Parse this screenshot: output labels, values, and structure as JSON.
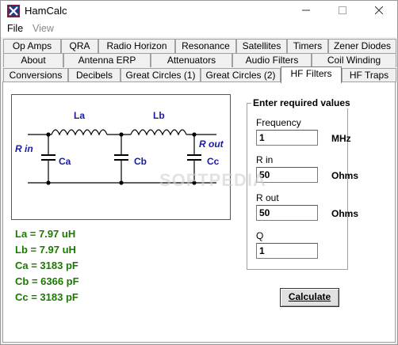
{
  "window": {
    "title": "HamCalc"
  },
  "menu": {
    "file": "File",
    "view": "View"
  },
  "tabs_row1": [
    "Op Amps",
    "QRA",
    "Radio Horizon",
    "Resonance",
    "Satellites",
    "Timers",
    "Zener Diodes"
  ],
  "tabs_row2": [
    "About",
    "Antenna ERP",
    "Attenuators",
    "Audio Filters",
    "Coil Winding"
  ],
  "tabs_row3": [
    "Conversions",
    "Decibels",
    "Great Circles (1)",
    "Great Circles (2)",
    "HF Filters",
    "HF Traps"
  ],
  "active_tab": "HF Filters",
  "diagram": {
    "la": "La",
    "lb": "Lb",
    "ca": "Ca",
    "cb": "Cb",
    "cc": "Cc",
    "rin": "R in",
    "rout": "R out"
  },
  "results": {
    "la": "La = 7.97 uH",
    "lb": "Lb = 7.97 uH",
    "ca": "Ca = 3183 pF",
    "cb": "Cb = 6366 pF",
    "cc": "Cc = 3183 pF"
  },
  "inputs": {
    "title": "Enter required values",
    "frequency": {
      "label": "Frequency",
      "value": "1",
      "unit": "MHz"
    },
    "rin": {
      "label": "R in",
      "value": "50",
      "unit": "Ohms"
    },
    "rout": {
      "label": "R out",
      "value": "50",
      "unit": "Ohms"
    },
    "q": {
      "label": "Q",
      "value": "1"
    }
  },
  "calculate_button": "Calculate",
  "watermark": "SOFTPEDIA",
  "colors": {
    "results": "#1a7a00",
    "diagram_labels": "#1a1aa0"
  }
}
